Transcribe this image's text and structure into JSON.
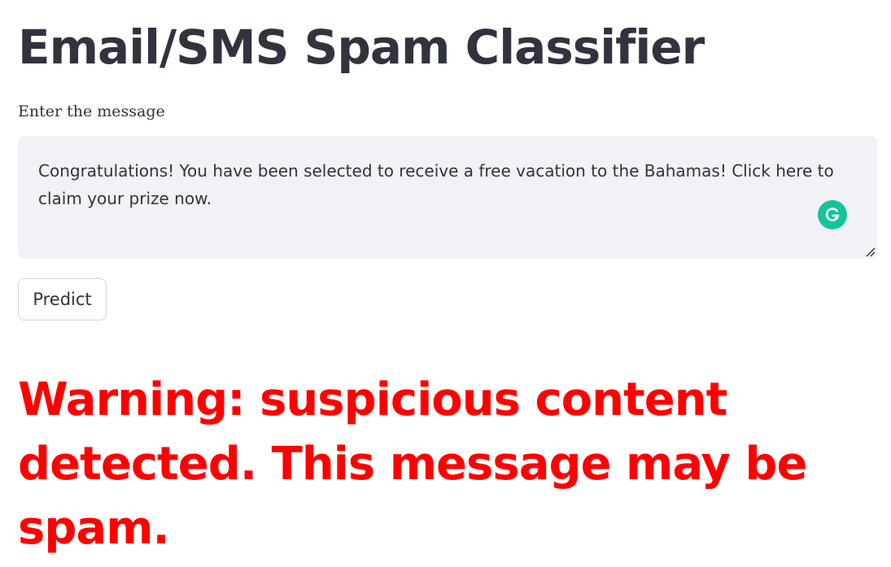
{
  "app": {
    "title": "Email/SMS Spam Classifier"
  },
  "input": {
    "label": "Enter the message",
    "value": "Congratulations! You have been selected to receive a free vacation to the Bahamas! Click here to claim your prize now."
  },
  "actions": {
    "predict_label": "Predict"
  },
  "result": {
    "message": "Warning: suspicious content detected. This message may be spam.",
    "color": "#ff0000"
  },
  "icons": {
    "grammarly": "grammarly-icon",
    "resize": "resize-handle-icon"
  },
  "colors": {
    "text": "#31333f",
    "input_bg": "#f0f2f6",
    "grammarly": "#15c39a"
  }
}
